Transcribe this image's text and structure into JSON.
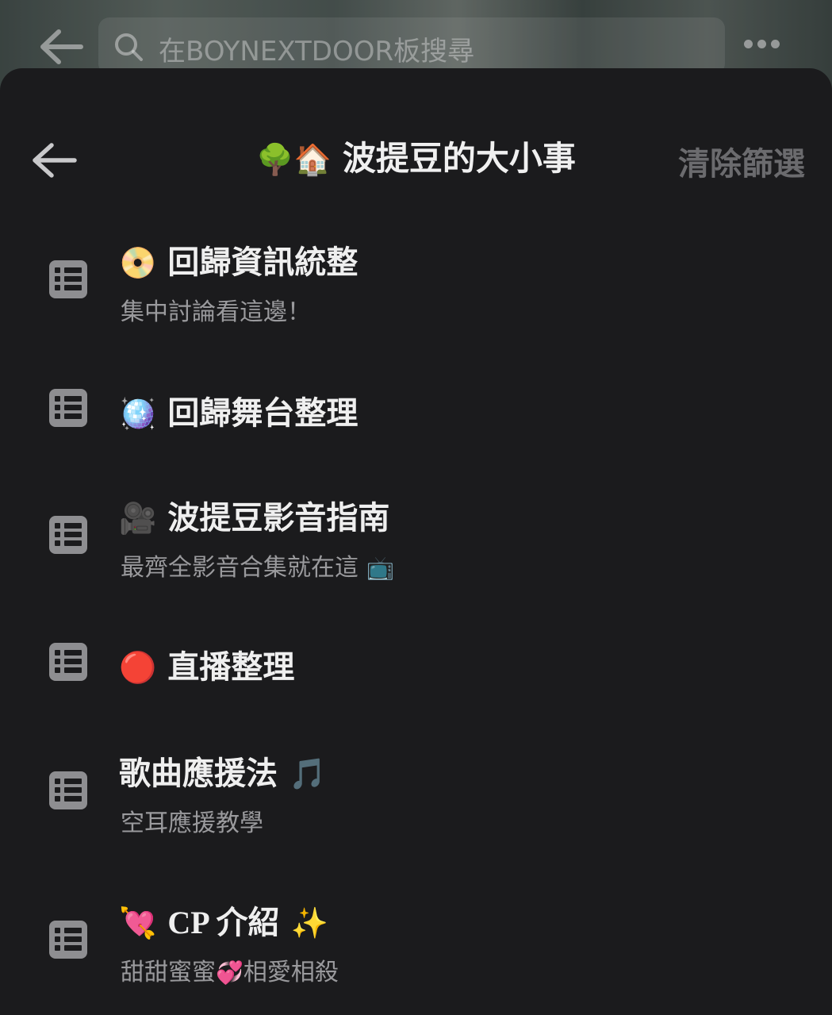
{
  "topbar": {
    "search_placeholder": "在BOYNEXTDOOR板搜尋",
    "back_icon": "arrow-left-icon",
    "more_icon": "more-dots-icon"
  },
  "header": {
    "title_emoji": "🌳🏠",
    "title": "波提豆的大小事",
    "clear_label": "清除篩選"
  },
  "items": [
    {
      "emoji": "📀",
      "title": "回歸資訊統整",
      "subtitle": "集中討論看這邊！",
      "sub_emoji": ""
    },
    {
      "emoji": "🪩",
      "title": "回歸舞台整理",
      "subtitle": "",
      "sub_emoji": ""
    },
    {
      "emoji": "🎥",
      "title": "波提豆影音指南",
      "subtitle": "最齊全影音合集就在這",
      "sub_emoji": "📺"
    },
    {
      "emoji": "🔴",
      "title": "直播整理",
      "subtitle": "",
      "sub_emoji": ""
    },
    {
      "emoji": "",
      "title": "歌曲應援法",
      "title_after_emoji": "🎵",
      "subtitle": "空耳應援教學",
      "sub_emoji": ""
    },
    {
      "emoji": "💘",
      "title": "CP 介紹",
      "title_after_emoji": "✨",
      "subtitle_a": "甜甜蜜蜜",
      "subtitle_emoji": "💞",
      "subtitle_b": "相愛相殺"
    }
  ]
}
